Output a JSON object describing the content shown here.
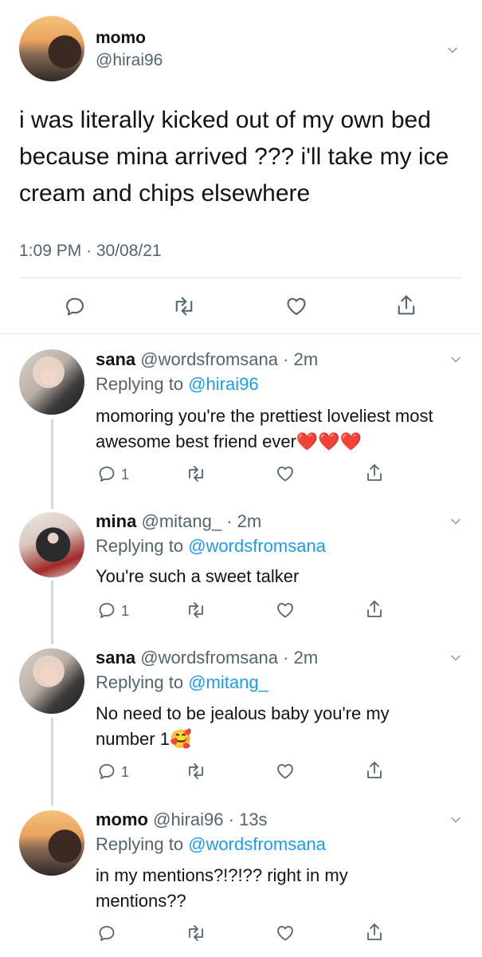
{
  "main_tweet": {
    "name": "momo",
    "handle": "@hirai96",
    "text": "i was literally kicked out of my own bed because mina arrived ??? i'll take my ice cream and chips elsewhere",
    "time": "1:09 PM · 30/08/21"
  },
  "replies": [
    {
      "name": "sana",
      "handle": "@wordsfromsana",
      "age": "· 2m",
      "replying_label": "Replying to ",
      "replying_to": "@hirai96",
      "text": "momoring you're the prettiest loveliest most awesome best friend ever❤️❤️❤️",
      "reply_count": "1"
    },
    {
      "name": "mina",
      "handle": "@mitang_",
      "age": "· 2m",
      "replying_label": "Replying to ",
      "replying_to": "@wordsfromsana",
      "text": "You're such a sweet talker",
      "reply_count": "1"
    },
    {
      "name": "sana",
      "handle": "@wordsfromsana",
      "age": "· 2m",
      "replying_label": "Replying to ",
      "replying_to": "@mitang_",
      "text": "No need to be jealous baby you're my number 1🥰",
      "reply_count": "1"
    },
    {
      "name": "momo",
      "handle": "@hirai96",
      "age": "· 13s",
      "replying_label": "Replying to ",
      "replying_to": "@wordsfromsana",
      "text": "in my mentions?!?!?? right in my mentions??",
      "reply_count": ""
    }
  ],
  "icons": [
    "chevron-down-icon",
    "reply-icon",
    "retweet-icon",
    "like-icon",
    "share-icon"
  ],
  "colors": {
    "link": "#1d9bf0",
    "secondary": "#536471",
    "text": "#0f1419",
    "thread_line": "#cfd9de"
  }
}
